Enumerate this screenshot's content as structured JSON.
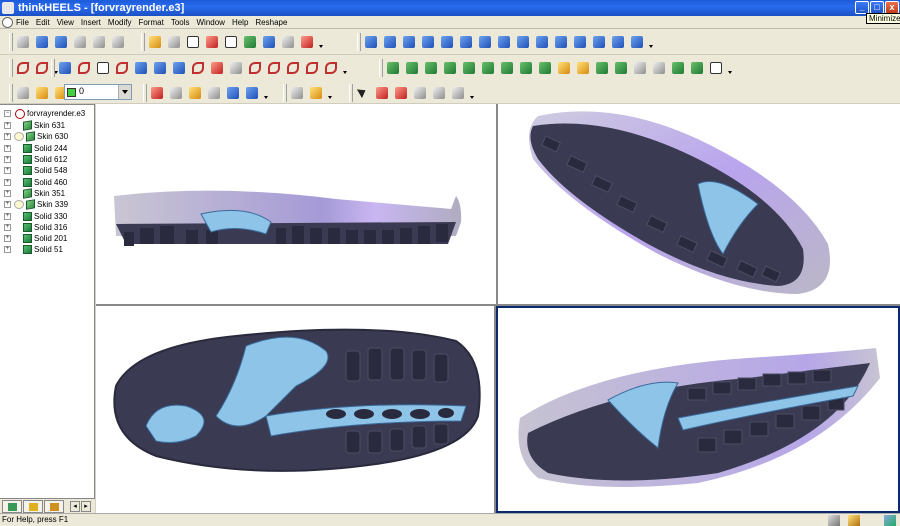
{
  "window": {
    "title": "thinkHEELS - [forvrayrender.e3]",
    "tooltip": "Minimize",
    "controls": {
      "minimize": "_",
      "maximize": "□",
      "close": "x"
    }
  },
  "menu": [
    "File",
    "Edit",
    "View",
    "Insert",
    "Modify",
    "Format",
    "Tools",
    "Window",
    "Help",
    "Reshape"
  ],
  "layer_select": {
    "value": "0",
    "swatch_color": "#43d13f"
  },
  "tree": {
    "root": "forvrayrender.e3",
    "items": [
      {
        "label": "Skin 631",
        "icon": "skin-icon",
        "edit": false
      },
      {
        "label": "Skin 630",
        "icon": "skin-icon",
        "edit": true
      },
      {
        "label": "Solid 244",
        "icon": "solid-icon",
        "edit": false
      },
      {
        "label": "Solid 612",
        "icon": "solid-icon",
        "edit": false
      },
      {
        "label": "Solid 548",
        "icon": "solid-icon",
        "edit": false
      },
      {
        "label": "Solid 460",
        "icon": "solid-icon",
        "edit": false
      },
      {
        "label": "Skin 351",
        "icon": "skin-icon",
        "edit": false
      },
      {
        "label": "Skin 339",
        "icon": "skin-icon",
        "edit": true
      },
      {
        "label": "Solid 330",
        "icon": "solid-icon",
        "edit": false
      },
      {
        "label": "Solid 316",
        "icon": "solid-icon",
        "edit": false
      },
      {
        "label": "Solid 201",
        "icon": "solid-icon",
        "edit": false
      },
      {
        "label": "Solid 51",
        "icon": "solid-icon",
        "edit": false
      }
    ]
  },
  "viewports": {
    "colors": {
      "outsole": "#3a3a52",
      "tread": "#2a2a3e",
      "midsole": "#b8b4c8",
      "accent": "#8ec4e8",
      "highlight": "#a78ce0"
    }
  },
  "status": {
    "message": "For Help, press F1"
  }
}
